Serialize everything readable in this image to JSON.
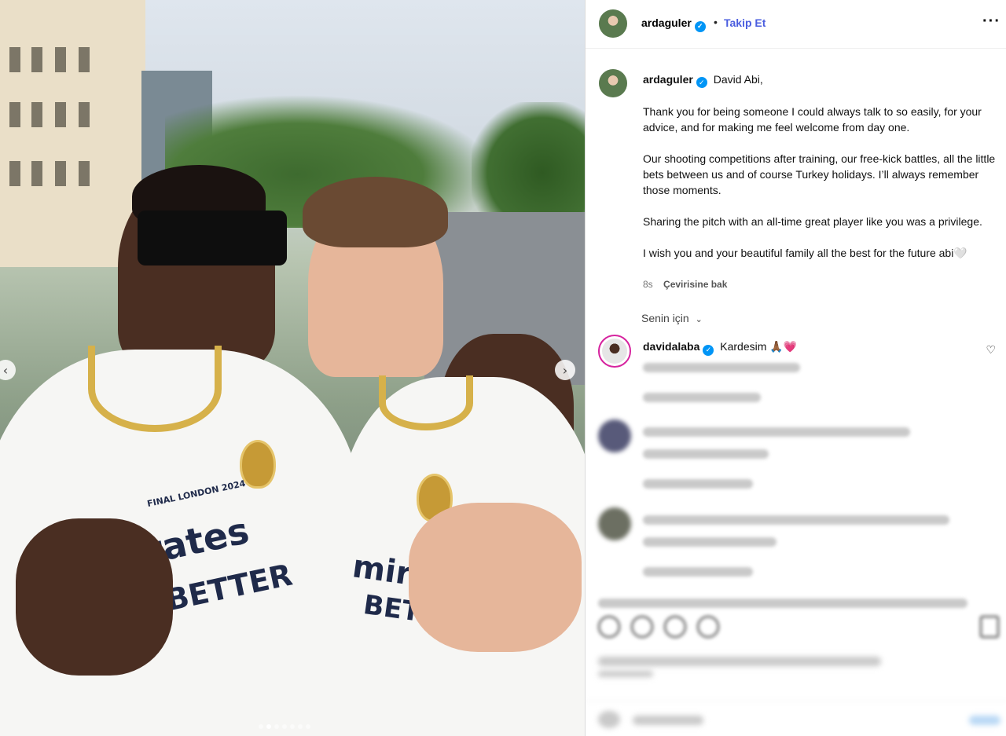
{
  "post": {
    "username": "ardaguler",
    "follow_label": "Takip Et",
    "more_icon": "more-horizontal-icon",
    "caption": {
      "greeting": "David Abi,",
      "paragraphs": [
        "Thank you for being someone I could always talk to so easily, for your advice, and for making me feel welcome from day one.",
        "Our shooting competitions after training, our free-kick battles, all the little bets between us and of course Turkey holidays. I’ll always remember those moments.",
        "Sharing the pitch with an all-time great player like you was a privilege.",
        "I wish you and your beautiful family all the best for the future abi🤍"
      ]
    },
    "time_ago": "8s",
    "see_translation": "Çevirisine bak",
    "for_you": "Senin için"
  },
  "photo": {
    "jersey_text_1": "mirates",
    "jersey_text_2": "BETTER",
    "final_label": "FINAL LONDON 2024",
    "carousel": {
      "total": 7,
      "active": 1
    },
    "nav_prev_icon": "chevron-left-icon",
    "nav_next_icon": "chevron-right-icon"
  },
  "comments": [
    {
      "username": "davidalaba",
      "text": "Kardesim 🙏🏾💗",
      "verified": true,
      "icon": "heart-icon"
    }
  ],
  "colors": {
    "verified": "#0095f6",
    "follow": "#4a5ddf",
    "accent": "#0095f6"
  }
}
